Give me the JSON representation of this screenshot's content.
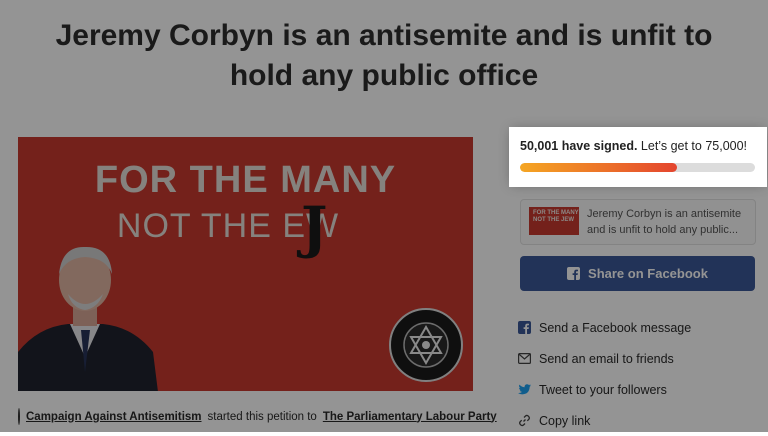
{
  "petition": {
    "title": "Jeremy Corbyn is an antisemite and is unfit to hold any public office"
  },
  "hero": {
    "line1": "FOR THE MANY",
    "line2": "NOT THE  EW",
    "scrawl": "J",
    "badge_text": "CAMPAIGN AGAINST ANTISEMITISM"
  },
  "starter": {
    "organizer": "Campaign Against Antisemitism",
    "action": "started this petition to",
    "recipient": "The Parliamentary Labour Party"
  },
  "progress": {
    "signed_text": "50,001 have signed.",
    "goal_text": "Let’s get to 75,000!",
    "signed": 50001,
    "goal": 75000,
    "fraction": 0.667
  },
  "share_preview": {
    "thumb_text": "FOR THE MANY NOT THE JEW",
    "text": "Jeremy Corbyn is an antisemite and is unfit to hold any public..."
  },
  "share": {
    "facebook_button": "Share on Facebook",
    "items": [
      {
        "icon": "facebook-icon",
        "label": "Send a Facebook message"
      },
      {
        "icon": "envelope-icon",
        "label": "Send an email to friends"
      },
      {
        "icon": "twitter-bird-icon",
        "label": "Tweet to your followers"
      },
      {
        "icon": "link-icon",
        "label": "Copy link"
      }
    ]
  },
  "colors": {
    "facebook": "#3b5998",
    "hero_red": "#c9392f",
    "bar_start": "#f5a623",
    "bar_end": "#e4452f"
  }
}
